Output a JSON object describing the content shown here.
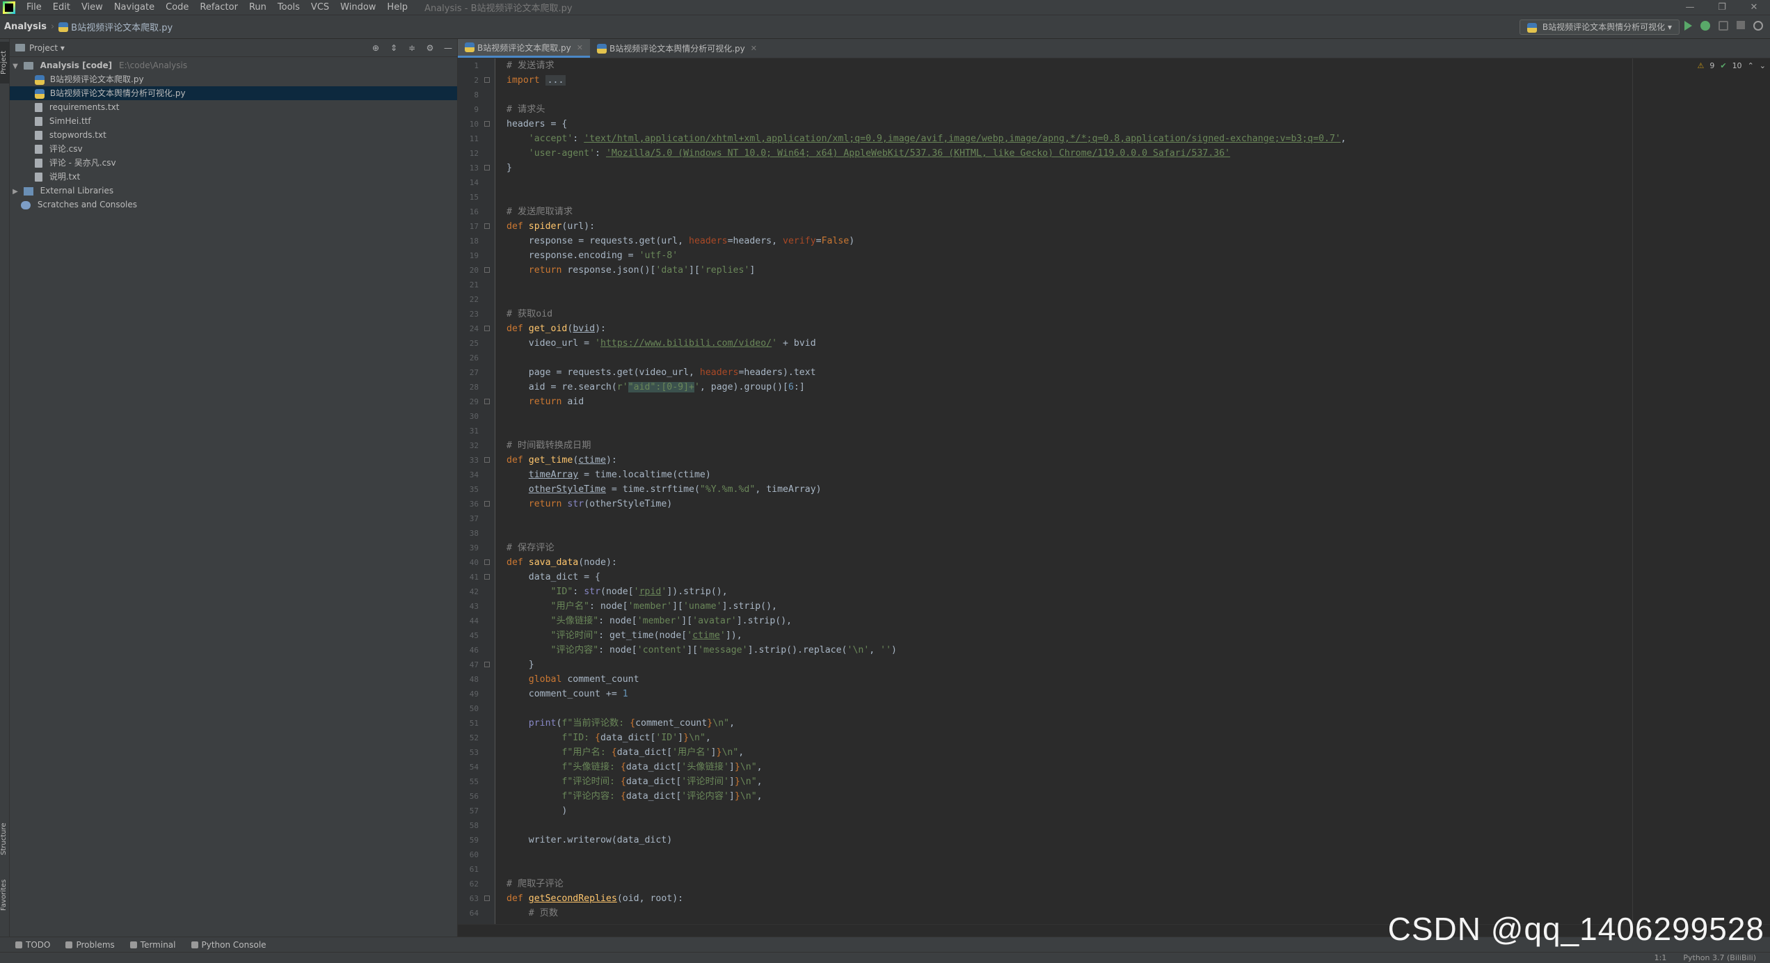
{
  "menubar": {
    "items": [
      "File",
      "Edit",
      "View",
      "Navigate",
      "Code",
      "Refactor",
      "Run",
      "Tools",
      "VCS",
      "Window",
      "Help"
    ],
    "title": "Analysis - B站视频评论文本爬取.py"
  },
  "navbar": {
    "project": "Analysis",
    "file": "B站视频评论文本爬取.py",
    "run_config": "B站视频评论文本舆情分析可视化"
  },
  "side_strip": {
    "project": "Project",
    "structure": "Structure",
    "favorites": "Favorites"
  },
  "project_panel": {
    "header": "Project",
    "root": "Analysis [code]",
    "root_path": "E:\\code\\Analysis",
    "files": [
      "B站视频评论文本爬取.py",
      "B站视频评论文本舆情分析可视化.py",
      "requirements.txt",
      "SimHei.ttf",
      "stopwords.txt",
      "评论.csv",
      "评论 - 吴亦凡.csv",
      "说明.txt"
    ],
    "external": "External Libraries",
    "scratches": "Scratches and Consoles"
  },
  "tabs": [
    "B站视频评论文本爬取.py",
    "B站视频评论文本舆情分析可视化.py"
  ],
  "inspections": {
    "warnings": "9",
    "ok": "10"
  },
  "code": {
    "line_numbers": [
      "1",
      "2",
      "8",
      "9",
      "10",
      "11",
      "12",
      "13",
      "14",
      "15",
      "16",
      "17",
      "18",
      "19",
      "20",
      "21",
      "22",
      "23",
      "24",
      "25",
      "26",
      "27",
      "28",
      "29",
      "30",
      "31",
      "32",
      "33",
      "34",
      "35",
      "36",
      "37",
      "38",
      "39",
      "40",
      "41",
      "42",
      "43",
      "44",
      "45",
      "46",
      "47",
      "48",
      "49",
      "50",
      "51",
      "52",
      "53",
      "54",
      "55",
      "56",
      "57",
      "58",
      "59",
      "60",
      "61",
      "62",
      "63",
      "64"
    ]
  },
  "bottom_tools": [
    "TODO",
    "Problems",
    "Terminal",
    "Python Console"
  ],
  "status": {
    "position": "1:1",
    "interpreter": "Python 3.7 (BiliBili)"
  },
  "watermark": "CSDN @qq_1406299528"
}
